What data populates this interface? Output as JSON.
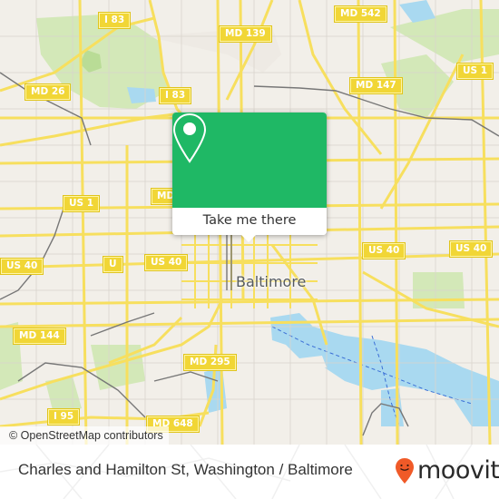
{
  "map": {
    "city_label": "Baltimore",
    "attribution": "© OpenStreetMap contributors",
    "road_shields": [
      {
        "label": "I 83",
        "id": "i83-north"
      },
      {
        "label": "MD 542",
        "id": "md542"
      },
      {
        "label": "MD 139",
        "id": "md139"
      },
      {
        "label": "MD 26",
        "id": "md26"
      },
      {
        "label": "I 83",
        "id": "i83-south"
      },
      {
        "label": "US 1",
        "id": "us1-east"
      },
      {
        "label": "MD 147",
        "id": "md147"
      },
      {
        "label": "MD",
        "id": "md-partial"
      },
      {
        "label": "US 1",
        "id": "us1-west"
      },
      {
        "label": "US 40",
        "id": "us40-far-west"
      },
      {
        "label": "U",
        "id": "us40-partial"
      },
      {
        "label": "US 40",
        "id": "us40-west"
      },
      {
        "label": "US 40",
        "id": "us40-center-east"
      },
      {
        "label": "US 40",
        "id": "us40-east"
      },
      {
        "label": "MD 144",
        "id": "md144"
      },
      {
        "label": "MD 295",
        "id": "md295"
      },
      {
        "label": "I 95",
        "id": "i95"
      },
      {
        "label": "MD 648",
        "id": "md648"
      }
    ],
    "colors": {
      "land": "#f2efe9",
      "road": "#f7df5e",
      "park": "#cfe6b0",
      "water": "#a9d9f0",
      "rail": "#777777"
    }
  },
  "popup": {
    "icon": "map-pin-icon",
    "button_label": "Take me there",
    "color": "#1fb865"
  },
  "footer": {
    "title": "Charles and Hamilton St, Washington / Baltimore",
    "brand": "moovit",
    "brand_icon": "moovit-smile-pin-icon",
    "brand_color": "#f05a28"
  }
}
